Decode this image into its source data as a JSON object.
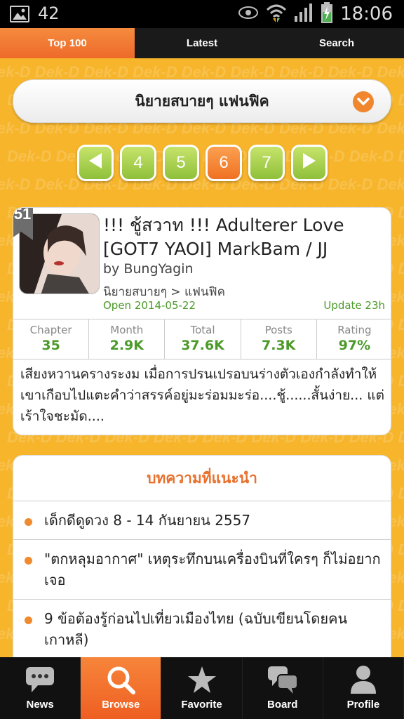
{
  "status_bar": {
    "notification_count": "42",
    "time": "18:06",
    "icons": [
      "image-icon",
      "eye-icon",
      "wifi-icon",
      "signal-icon",
      "battery-charging-icon"
    ]
  },
  "tabs": [
    {
      "label": "Top 100",
      "active": true
    },
    {
      "label": "Latest",
      "active": false
    },
    {
      "label": "Search",
      "active": false
    }
  ],
  "watermark": "Dek-D",
  "category_dropdown": {
    "label": "นิยายสบายๆ แฟนฟิค",
    "icon": "chevron-down-icon"
  },
  "pager": {
    "prev_icon": "arrow-left-icon",
    "next_icon": "arrow-right-icon",
    "pages": [
      "4",
      "5",
      "6",
      "7"
    ],
    "current": "6"
  },
  "story": {
    "rank": "51",
    "title": "!!! ชู้สวาท !!! Adulterer Love [GOT7 YAOI] MarkBam / JJ",
    "author": "by BungYagin",
    "category": "นิยายสบายๆ > แฟนฟิค",
    "open_date": "Open 2014-05-22",
    "update": "Update 23h",
    "stats": [
      {
        "label": "Chapter",
        "value": "35"
      },
      {
        "label": "Month",
        "value": "2.9K"
      },
      {
        "label": "Total",
        "value": "37.6K"
      },
      {
        "label": "Posts",
        "value": "7.3K"
      },
      {
        "label": "Rating",
        "value": "97%"
      }
    ],
    "description": "เสียงหวานครางระงม เมื่อการปรนเปรอบนร่างตัวเองกำลังทำให้เขาเกือบไปแตะคำว่าสรรค์อยู่มะร่อมมะร่อ....ชู้......สั้นง่าย... แต่เร้าใจชะมัด...."
  },
  "recommended": {
    "title": "บทความที่แนะนำ",
    "items": [
      "เด็กดีดูดวง 8 - 14 กันยายน 2557",
      "\"ตกหลุมอากาศ\" เหตุระทึกบนเครื่องบินที่ใครๆ ก็ไม่อยากเจอ",
      "9 ข้อต้องรู้ก่อนไปเที่ยวเมืองไทย (ฉบับเขียนโดยคนเกาหลี)"
    ]
  },
  "bottom_nav": [
    {
      "label": "News",
      "icon": "chat-bubble-icon",
      "active": false
    },
    {
      "label": "Browse",
      "icon": "search-icon",
      "active": true
    },
    {
      "label": "Favorite",
      "icon": "star-icon",
      "active": false
    },
    {
      "label": "Board",
      "icon": "chat-bubbles-icon",
      "active": false
    },
    {
      "label": "Profile",
      "icon": "person-icon",
      "active": false
    }
  ],
  "colors": {
    "background": "#f7b52c",
    "accent_orange": "#f07123",
    "pager_green": "#8fc03a",
    "stat_green": "#4c9a2a",
    "title_orange": "#e8702c"
  }
}
